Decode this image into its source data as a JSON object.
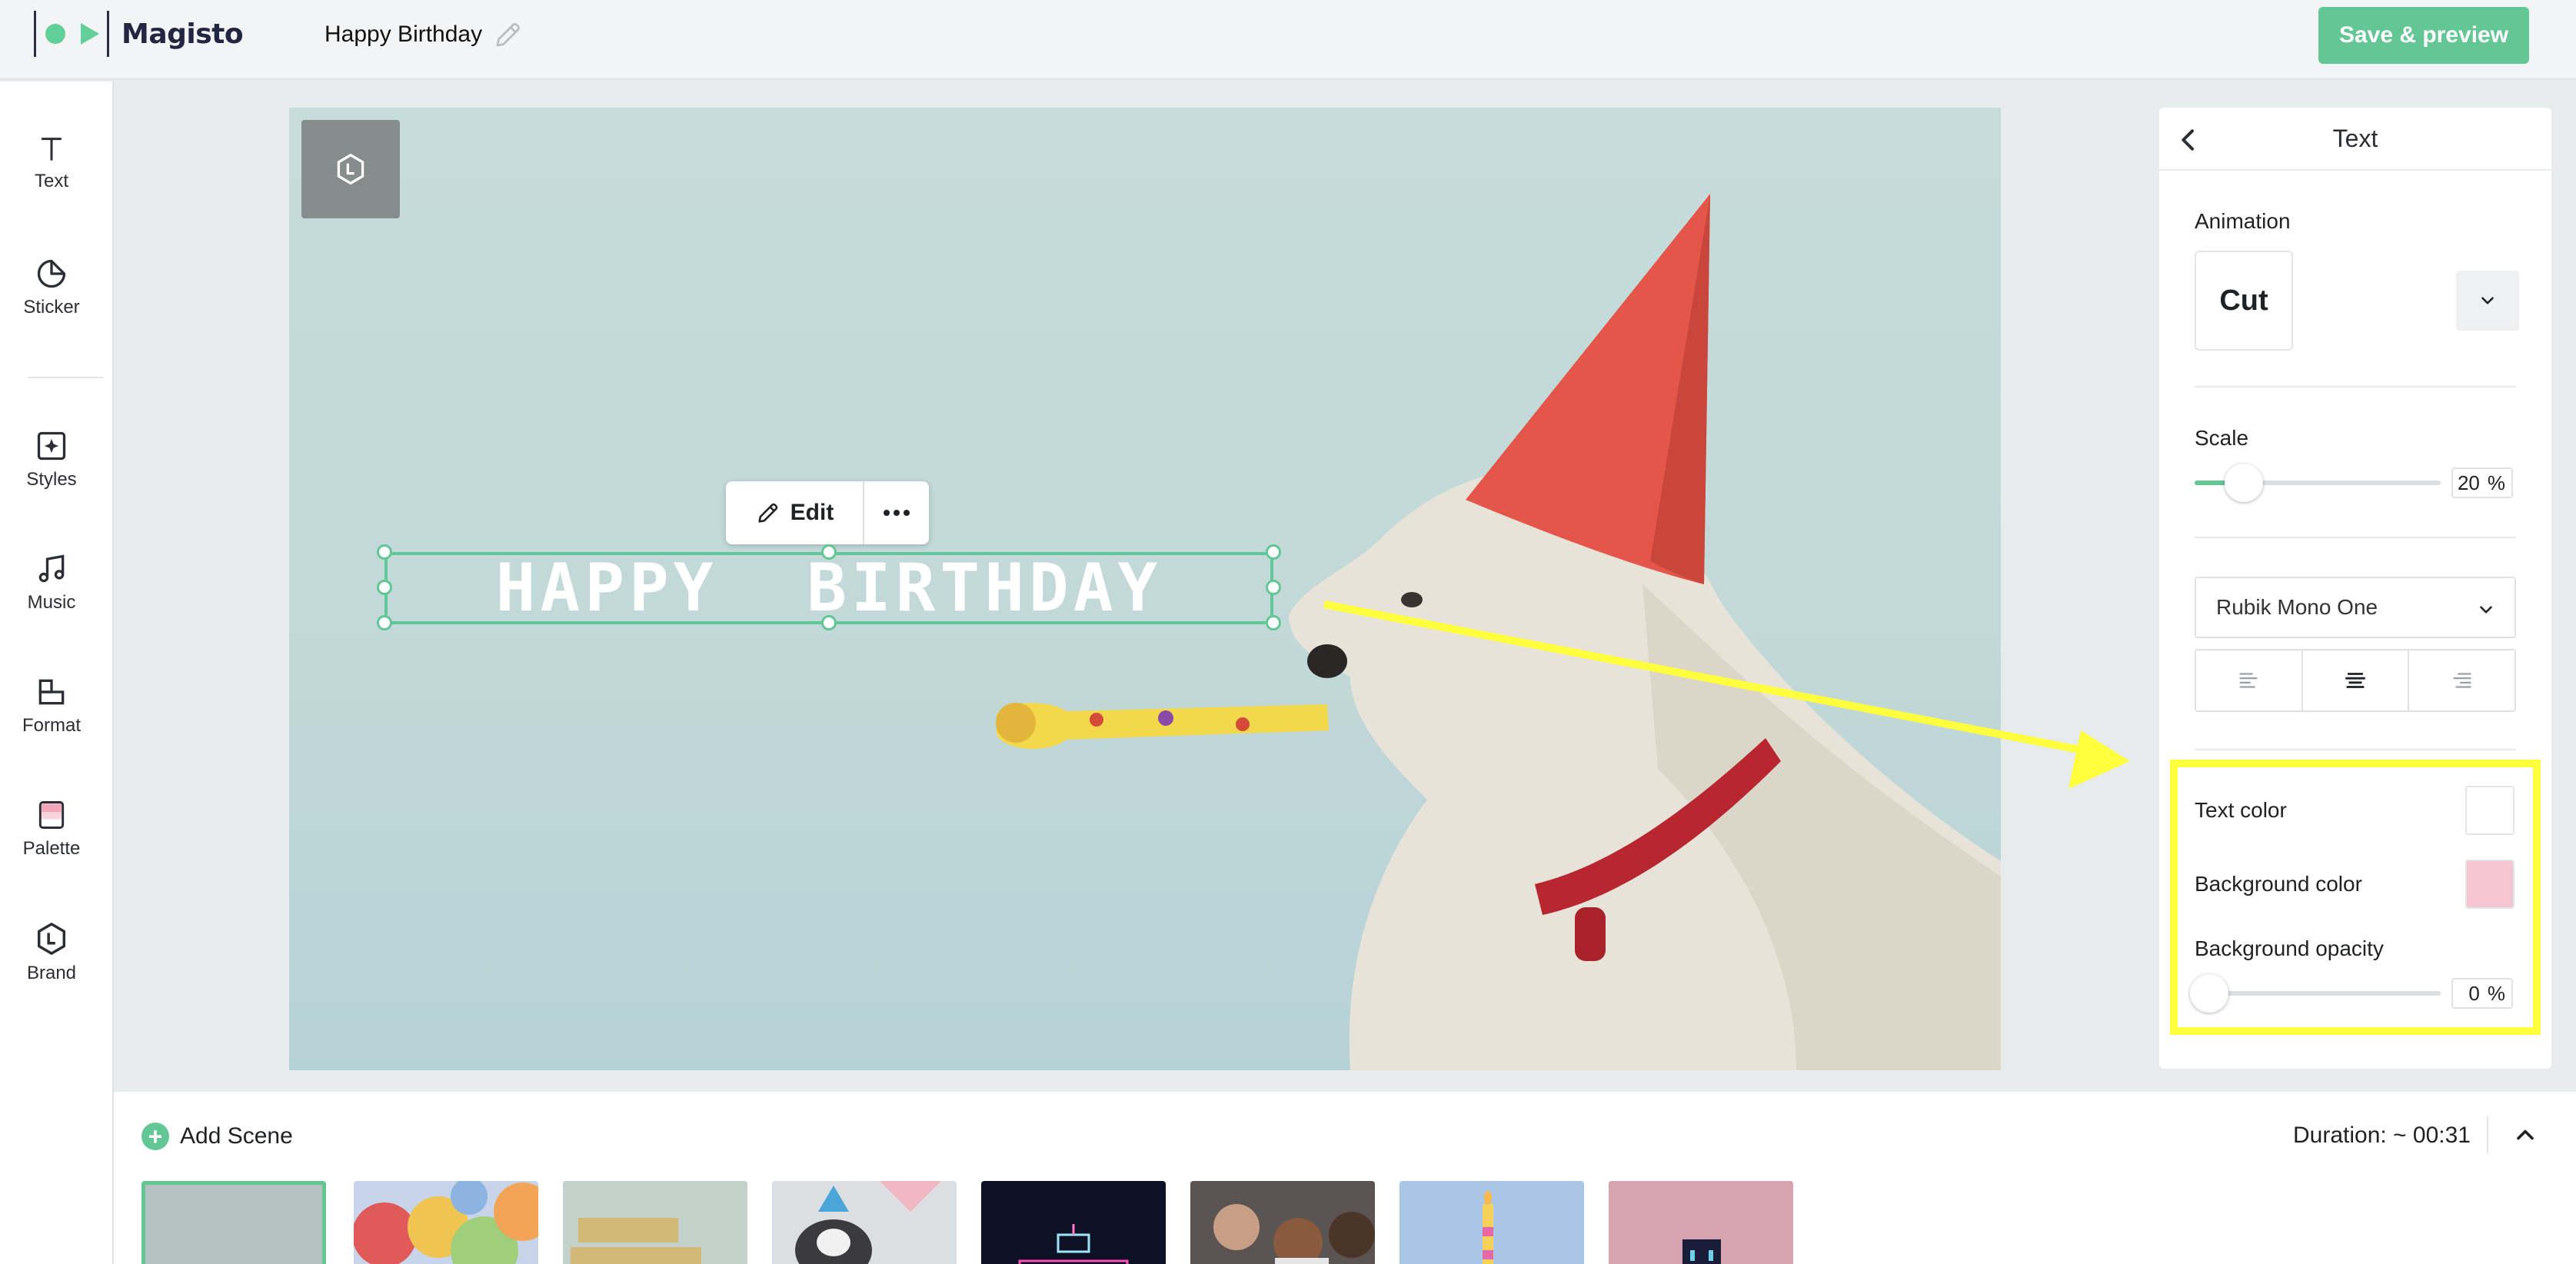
{
  "header": {
    "brand": "Magisto",
    "project_title": "Happy Birthday",
    "save_label": "Save & preview"
  },
  "sidebar": {
    "items": [
      {
        "label": "Text",
        "icon": "text-icon"
      },
      {
        "label": "Sticker",
        "icon": "sticker-icon"
      },
      {
        "label": "Styles",
        "icon": "styles-icon"
      },
      {
        "label": "Music",
        "icon": "music-note-icon"
      },
      {
        "label": "Format",
        "icon": "format-icon"
      },
      {
        "label": "Palette",
        "icon": "palette-icon"
      },
      {
        "label": "Brand",
        "icon": "brand-icon"
      }
    ]
  },
  "canvas": {
    "overlay_text": "HAPPY  BIRTHDAY",
    "edit_label": "Edit"
  },
  "panel": {
    "title": "Text",
    "animation_label": "Animation",
    "animation_value": "Cut",
    "scale_label": "Scale",
    "scale_value": "20",
    "scale_unit": "%",
    "scale_level": 0.2,
    "font_value": "Rubik Mono One",
    "alignment_options": [
      "left",
      "center",
      "right"
    ],
    "alignment_selected": "center",
    "text_color_label": "Text color",
    "text_color": "#ffffff",
    "bg_color_label": "Background color",
    "bg_color": "#f4c6d2",
    "bg_opacity_label": "Background opacity",
    "bg_opacity_value": "0",
    "bg_opacity_unit": "%",
    "bg_opacity_level": 0
  },
  "timeline": {
    "add_scene_label": "Add Scene",
    "duration": "Duration: ~ 00:31",
    "scenes": [
      "scene-1",
      "scene-2",
      "scene-3",
      "scene-4",
      "scene-5",
      "scene-6",
      "scene-7",
      "scene-8"
    ]
  },
  "colors": {
    "accent": "#63c795",
    "highlight": "#ffff3d"
  }
}
